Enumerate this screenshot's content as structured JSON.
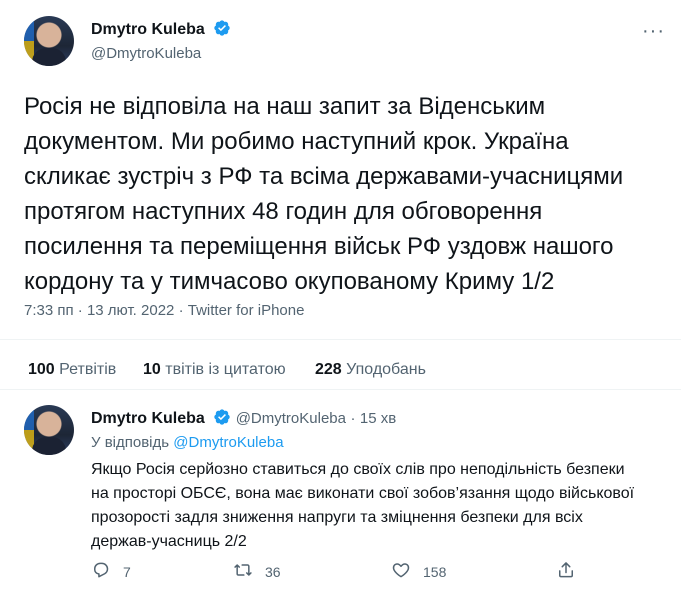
{
  "tweet": {
    "author_name": "Dmytro Kuleba",
    "author_handle": "@DmytroKuleba",
    "more_label": "···",
    "text_lines": [
      "Росія не відповіла на наш запит за Віденським",
      "документом. Ми робимо наступний крок. Україна",
      "скликає зустріч з РФ та всіма державами-учасницями",
      "протягом наступних 48 годин для обговорення",
      "посилення та переміщення військ РФ уздовж нашого",
      "кордону та у тимчасово окупованому Криму 1/2"
    ],
    "time": "7:33 пп",
    "sep1": "·",
    "date": "13 лют. 2022",
    "sep2": "·",
    "source": "Twitter for iPhone"
  },
  "stats": {
    "retweets_count": "100",
    "retweets_label": "Ретвітів",
    "quotes_count": "10",
    "quotes_label": "твітів із цитатою",
    "likes_count": "228",
    "likes_label": "Уподобань"
  },
  "reply": {
    "author_name": "Dmytro Kuleba",
    "author_handle": "@DmytroKuleba",
    "dot": "·",
    "time": "15 хв",
    "replying_prefix": "У відповідь",
    "replying_handle": "@DmytroKuleba",
    "text_lines": [
      "Якщо Росія серйозно ставиться до своїх слів про неподільність безпеки",
      "на просторі ОБСЄ, вона має виконати свої зобов’язання щодо військової",
      "прозорості задля зниження напруги та зміцнення безпеки для всіх",
      "держав-учасниць 2/2"
    ],
    "actions": {
      "reply_count": "7",
      "retweet_count": "36",
      "like_count": "158"
    }
  },
  "colors": {
    "verified": "#1d9bf0",
    "link": "#1d9bf0",
    "muted": "#536471",
    "text": "#0f1419"
  }
}
